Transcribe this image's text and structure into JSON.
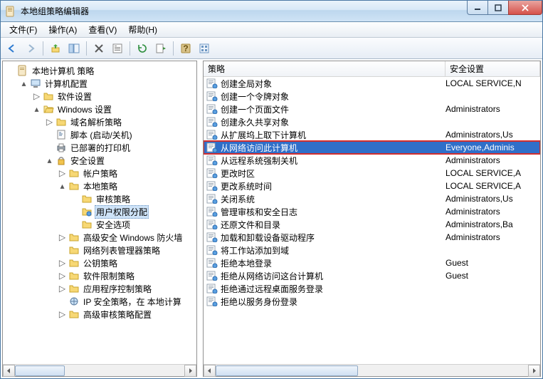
{
  "window": {
    "title": "本地组策略编辑器"
  },
  "menu": {
    "file": "文件(F)",
    "action": "操作(A)",
    "view": "查看(V)",
    "help": "帮助(H)"
  },
  "tree": {
    "root": "本地计算机 策略",
    "computer_config": "计算机配置",
    "software_settings": "软件设置",
    "windows_settings": "Windows 设置",
    "name_resolution": "域名解析策略",
    "scripts": "脚本 (启动/关机)",
    "deployed_printers": "已部署的打印机",
    "security_settings": "安全设置",
    "account_policies": "帐户策略",
    "local_policies": "本地策略",
    "audit_policy": "审核策略",
    "user_rights": "用户权限分配",
    "security_options": "安全选项",
    "wfas": "高级安全 Windows 防火墙",
    "nlm": "网络列表管理器策略",
    "public_key": "公钥策略",
    "software_restriction": "软件限制策略",
    "app_control": "应用程序控制策略",
    "ipsec": "IP 安全策略，在 本地计算",
    "advanced_audit": "高级审核策略配置"
  },
  "list": {
    "col_policy": "策略",
    "col_security": "安全设置",
    "rows": [
      {
        "name": "创建全局对象",
        "value": "LOCAL SERVICE,N"
      },
      {
        "name": "创建一个令牌对象",
        "value": ""
      },
      {
        "name": "创建一个页面文件",
        "value": "Administrators"
      },
      {
        "name": "创建永久共享对象",
        "value": ""
      },
      {
        "name": "从扩展坞上取下计算机",
        "value": "Administrators,Us"
      },
      {
        "name": "从网络访问此计算机",
        "value": "Everyone,Adminis",
        "selected": true
      },
      {
        "name": "从远程系统强制关机",
        "value": "Administrators"
      },
      {
        "name": "更改时区",
        "value": "LOCAL SERVICE,A"
      },
      {
        "name": "更改系统时间",
        "value": "LOCAL SERVICE,A"
      },
      {
        "name": "关闭系统",
        "value": "Administrators,Us"
      },
      {
        "name": "管理审核和安全日志",
        "value": "Administrators"
      },
      {
        "name": "还原文件和目录",
        "value": "Administrators,Ba"
      },
      {
        "name": "加载和卸载设备驱动程序",
        "value": "Administrators"
      },
      {
        "name": "将工作站添加到域",
        "value": ""
      },
      {
        "name": "拒绝本地登录",
        "value": "Guest"
      },
      {
        "name": "拒绝从网络访问这台计算机",
        "value": "Guest"
      },
      {
        "name": "拒绝通过远程桌面服务登录",
        "value": ""
      },
      {
        "name": "拒绝以服务身份登录",
        "value": ""
      }
    ]
  }
}
